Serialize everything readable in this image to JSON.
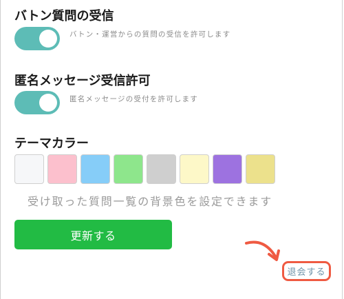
{
  "baton": {
    "title": "バトン質問の受信",
    "toggle_on": true,
    "description": "バトン・運営からの質問の受信を許可します"
  },
  "anonymous": {
    "title": "匿名メッセージ受信許可",
    "toggle_on": true,
    "description": "匿名メッセージの受付を許可します"
  },
  "theme": {
    "title": "テーマカラー",
    "swatches": [
      "#f6f7f9",
      "#fcc0cd",
      "#86cdf8",
      "#8ee68c",
      "#cfcfcf",
      "#fdf8c8",
      "#9d72e0",
      "#ece18c"
    ],
    "note": "受け取った質問一覧の背景色を設定できます"
  },
  "update_button": {
    "label": "更新する",
    "color": "#22bb44"
  },
  "withdraw_link": {
    "label": "退会する"
  },
  "colors": {
    "toggle": "#5dbcb6",
    "annotation": "#ef5a42",
    "link": "#6f93a8"
  }
}
